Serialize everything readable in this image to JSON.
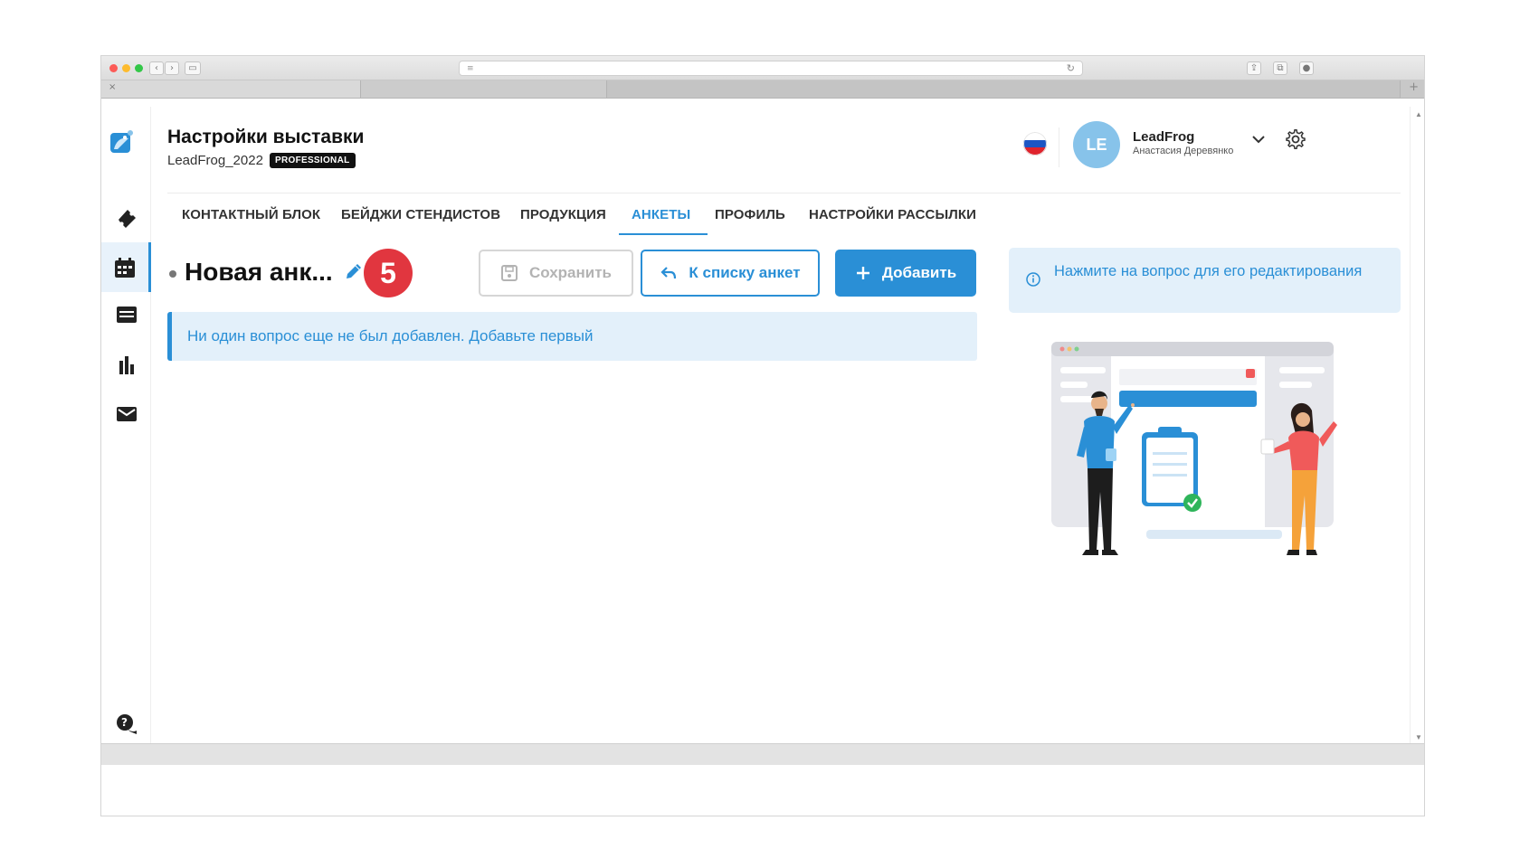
{
  "browser": {
    "tab_close_glyph": "×",
    "new_tab_glyph": "+"
  },
  "header": {
    "title": "Настройки выставки",
    "exhibition_name": "LeadFrog_2022",
    "plan_badge": "PROFESSIONAL",
    "language_flag": "ru",
    "user": {
      "initials": "LE",
      "company": "LeadFrog",
      "name": "Анастасия Деревянко"
    }
  },
  "sidebar": {
    "items": [
      {
        "icon": "ticket-icon"
      },
      {
        "icon": "calendar-grid-icon",
        "active": true
      },
      {
        "icon": "inbox-icon"
      },
      {
        "icon": "bar-chart-icon"
      },
      {
        "icon": "mail-icon"
      },
      {
        "icon": "help-chat-icon"
      }
    ]
  },
  "tabs": [
    {
      "label": "КОНТАКТНЫЙ БЛОК"
    },
    {
      "label": "БЕЙДЖИ СТЕНДИСТОВ"
    },
    {
      "label": "ПРОДУКЦИЯ"
    },
    {
      "label": "АНКЕТЫ",
      "active": true
    },
    {
      "label": "ПРОФИЛЬ"
    },
    {
      "label": "НАСТРОЙКИ РАССЫЛКИ"
    }
  ],
  "form": {
    "title": "Новая анк...",
    "step_number": "5",
    "save_label": "Сохранить",
    "back_label": "К списку анкет",
    "add_label": "Добавить",
    "empty_message": "Ни один вопрос еще не был добавлен. Добавьте первый"
  },
  "hint": {
    "text": "Нажмите на вопрос для его редактирования"
  },
  "colors": {
    "accent": "#2a8fd6",
    "step_badge": "#e1363f",
    "alert_bg": "#e3f0fa"
  }
}
